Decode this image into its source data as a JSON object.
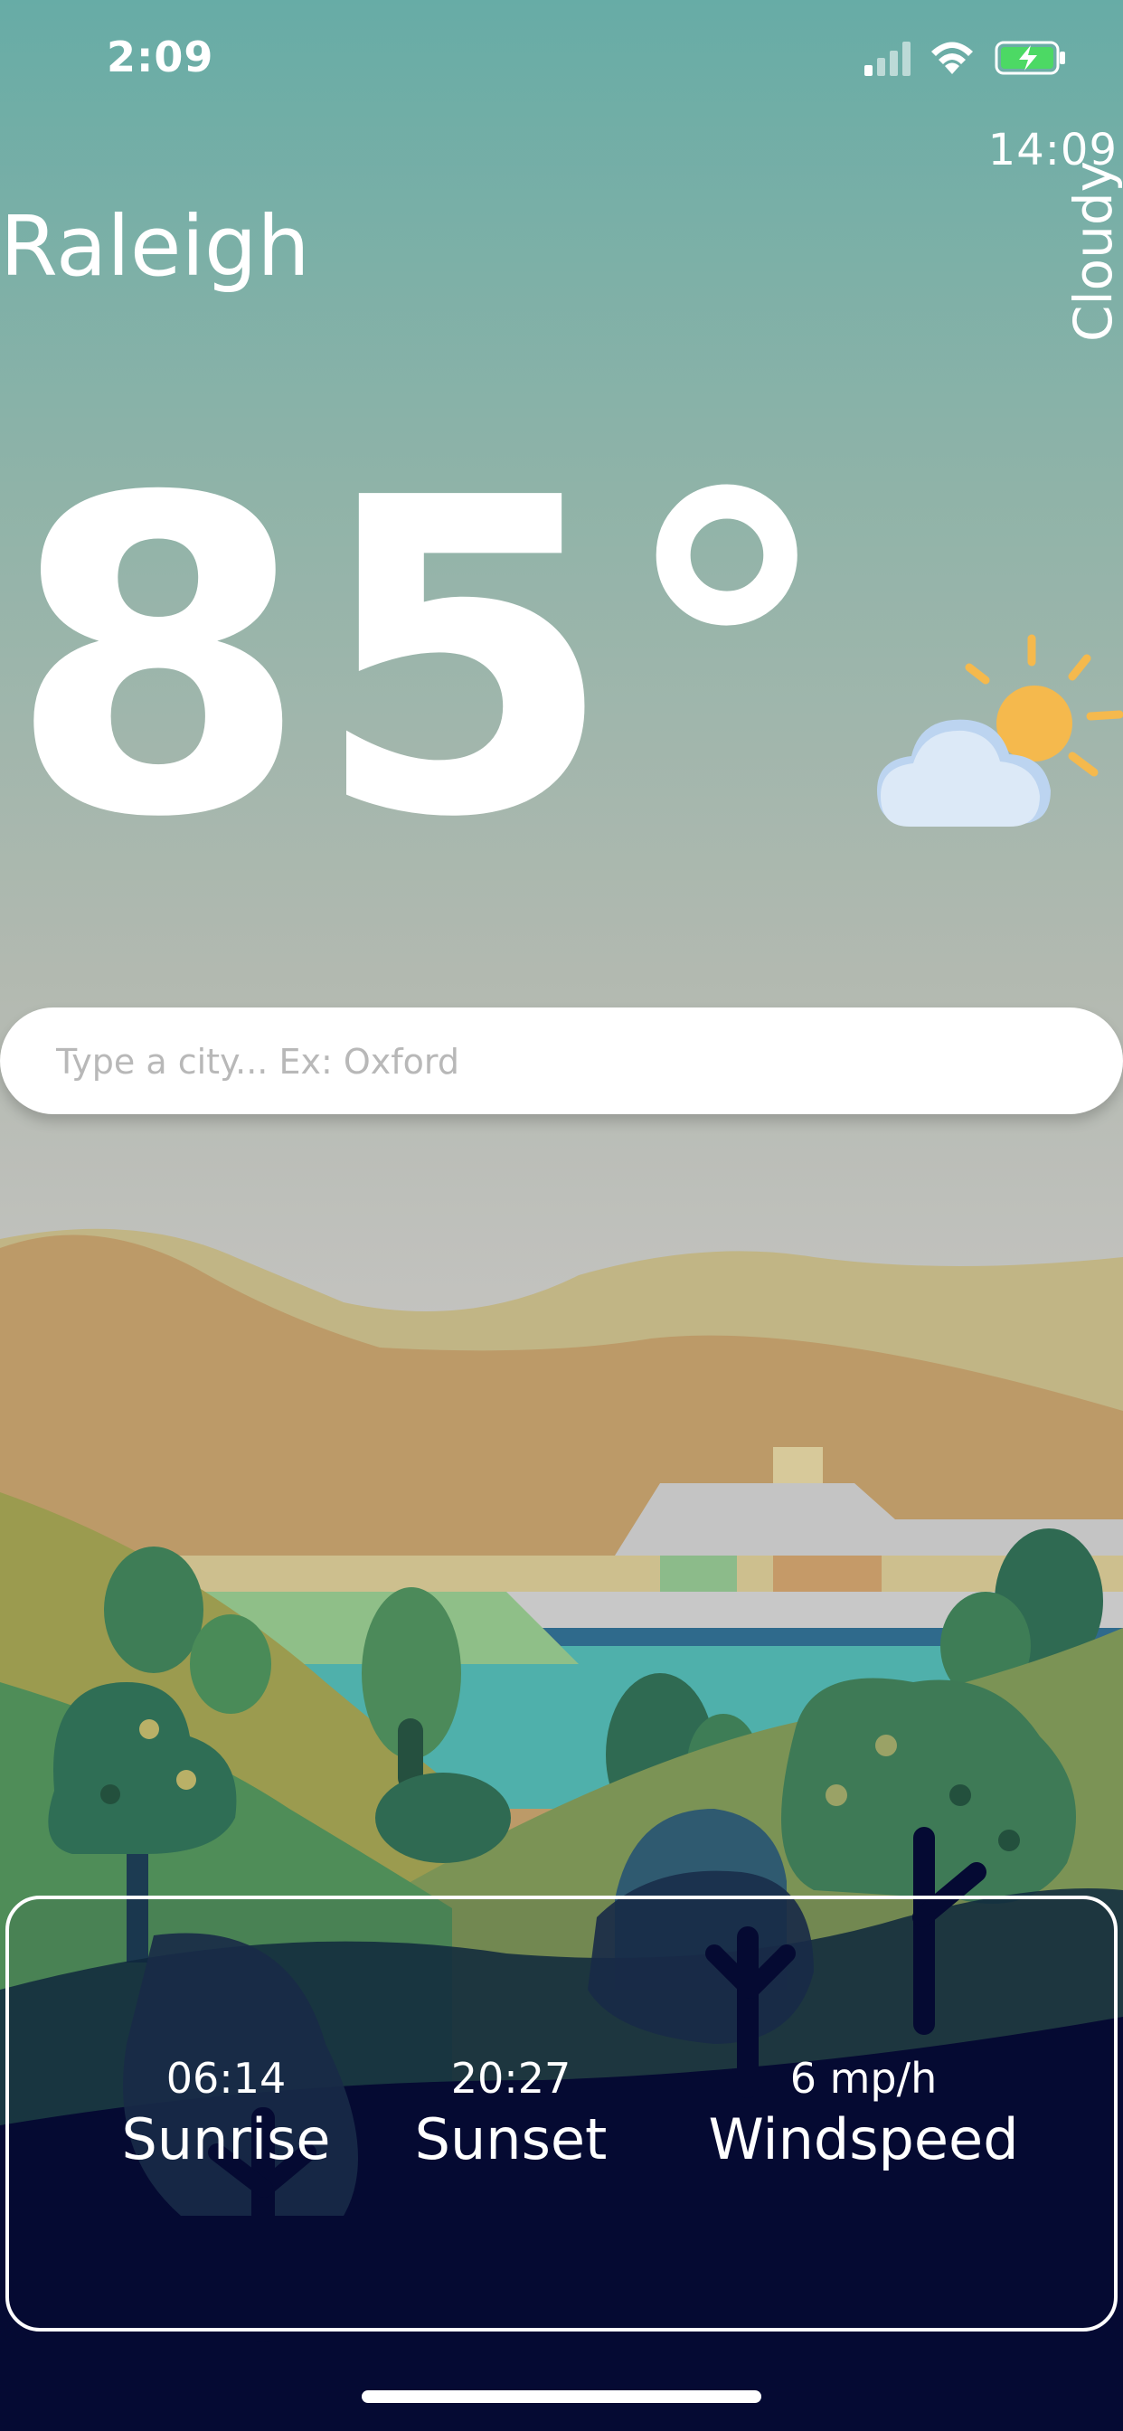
{
  "status_bar": {
    "time": "2:09"
  },
  "weather": {
    "local_time": "14:09",
    "city": "Raleigh",
    "condition": "Cloudy",
    "temperature": "85°",
    "icon": "partly-cloudy-icon"
  },
  "search": {
    "placeholder": "Type a city... Ex: Oxford",
    "value": ""
  },
  "details": {
    "sunrise": {
      "value": "06:14",
      "label": "Sunrise"
    },
    "sunset": {
      "value": "20:27",
      "label": "Sunset"
    },
    "windspeed": {
      "value": "6 mp/h",
      "label": "Windspeed"
    }
  },
  "colors": {
    "sky_top": "#67aca6",
    "sun": "#f5b94d",
    "cloud": "#dce9f7",
    "night_navy": "#050a33"
  }
}
